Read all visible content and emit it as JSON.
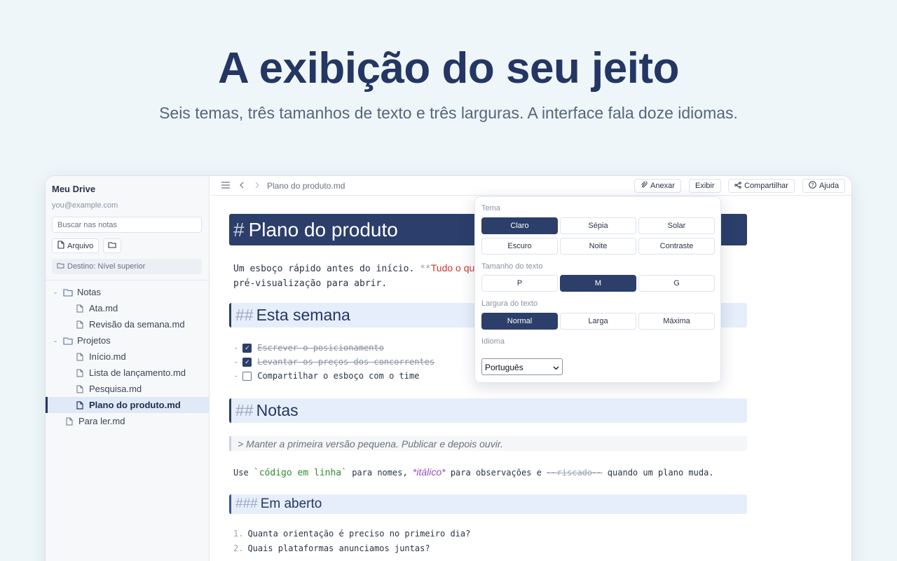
{
  "hero": {
    "title": "A exibição do seu jeito",
    "subtitle": "Seis temas, três tamanhos de texto e três larguras. A interface fala doze idiomas."
  },
  "sidebar": {
    "title": "Meu Drive",
    "email": "you@example.com",
    "search_placeholder": "Buscar nas notas",
    "file_button": "Arquivo",
    "destination": "Destino: Nível superior",
    "tree": [
      {
        "label": "Notas",
        "type": "folder",
        "depth": 0,
        "expanded": true
      },
      {
        "label": "Ata.md",
        "type": "file",
        "depth": 1
      },
      {
        "label": "Revisão da semana.md",
        "type": "file",
        "depth": 1
      },
      {
        "label": "Projetos",
        "type": "folder",
        "depth": 0,
        "expanded": true
      },
      {
        "label": "Início.md",
        "type": "file",
        "depth": 1
      },
      {
        "label": "Lista de lançamento.md",
        "type": "file",
        "depth": 1
      },
      {
        "label": "Pesquisa.md",
        "type": "file",
        "depth": 1
      },
      {
        "label": "Plano do produto.md",
        "type": "file",
        "depth": 1,
        "active": true
      },
      {
        "label": "Para ler.md",
        "type": "file",
        "depth": 0
      }
    ]
  },
  "topbar": {
    "breadcrumb": "Plano do produto.md",
    "attach": "Anexar",
    "view": "Exibir",
    "share": "Compartilhar",
    "help": "Ajuda"
  },
  "doc": {
    "h1_mark": "#",
    "h1": "Plano do produto",
    "p1_a": "Um esboço rápido antes do início. ",
    "p1_mark": "**",
    "p1_bold": "Tudo o que v",
    "p1_b": "pré-visualização para abrir.",
    "h2a_mark": "##",
    "h2a": "Esta semana",
    "tasks": [
      {
        "text": "Escrever o posicionamento",
        "done": true
      },
      {
        "text": "Levantar os preços dos concorrentes",
        "done": true
      },
      {
        "text": "Compartilhar o esboço com o time",
        "done": false
      }
    ],
    "task_dash": "-",
    "h2b_mark": "##",
    "h2b": "Notas",
    "quote": "> Manter a primeira versão pequena. Publicar e depois ouvir.",
    "p2_use": "Use ",
    "p2_code": "`código em linha`",
    "p2_mid1": " para nomes, ",
    "p2_it": "*itálico*",
    "p2_mid2": " para observações e ",
    "p2_strike": "~~riscado~~",
    "p2_end": " quando um plano muda.",
    "h3_mark": "###",
    "h3": "Em aberto",
    "list": [
      {
        "n": "1.",
        "text": "Quanta orientação é preciso no primeiro dia?"
      },
      {
        "n": "2.",
        "text": "Quais plataformas anunciamos juntas?"
      }
    ]
  },
  "popover": {
    "theme_label": "Tema",
    "themes": [
      "Claro",
      "Sépia",
      "Solar",
      "Escuro",
      "Noite",
      "Contraste"
    ],
    "theme_selected": "Claro",
    "size_label": "Tamanho do texto",
    "sizes": [
      "P",
      "M",
      "G"
    ],
    "size_selected": "M",
    "width_label": "Largura do texto",
    "widths": [
      "Normal",
      "Larga",
      "Máxima"
    ],
    "width_selected": "Normal",
    "language_label": "Idioma",
    "language_value": "Português"
  },
  "colors": {
    "accent": "#2c3e6a",
    "background": "#eef6f9",
    "red_bold": "#d1332e",
    "code_green": "#2e8b2e",
    "italic_purple": "#9b4db8"
  }
}
